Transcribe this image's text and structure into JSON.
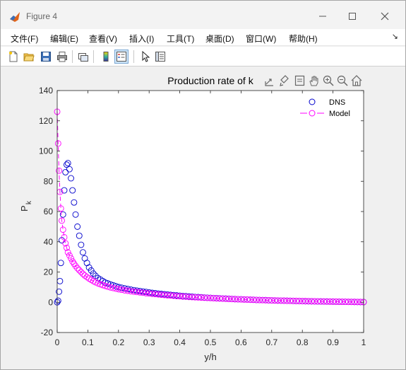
{
  "window": {
    "title": "Figure 4"
  },
  "menu": {
    "items": [
      "文件(F)",
      "编辑(E)",
      "查看(V)",
      "插入(I)",
      "工具(T)",
      "桌面(D)",
      "窗口(W)",
      "帮助(H)"
    ]
  },
  "toolbar": {
    "icons": [
      "new-figure-icon",
      "open-file-icon",
      "save-icon",
      "print-icon",
      "link-plot-icon",
      "colorbar-icon",
      "legend-icon",
      "pointer-icon",
      "property-inspector-icon"
    ]
  },
  "axes_toolbar": {
    "icons": [
      "export-icon",
      "brush-icon",
      "data-tip-icon",
      "pan-icon",
      "zoom-in-icon",
      "zoom-out-icon",
      "home-icon"
    ]
  },
  "colors": {
    "dns": "#0000cc",
    "model": "#ff00ff",
    "figure_bg": "#f0f0f0"
  },
  "chart_data": {
    "type": "scatter",
    "title": "Production rate of k",
    "xlabel": "y/h",
    "ylabel": "P",
    "ylabel_subscript": "k",
    "xlim": [
      0,
      1
    ],
    "ylim": [
      -20,
      140
    ],
    "xticks": [
      "0",
      "0.1",
      "0.2",
      "0.3",
      "0.4",
      "0.5",
      "0.6",
      "0.7",
      "0.8",
      "0.9",
      "1"
    ],
    "yticks": [
      "-20",
      "0",
      "20",
      "40",
      "60",
      "80",
      "100",
      "120",
      "140"
    ],
    "grid": false,
    "legend_position": "top-right",
    "series": [
      {
        "name": "DNS",
        "marker": "circle",
        "line": "none",
        "x": [
          0.0,
          0.003,
          0.006,
          0.009,
          0.012,
          0.015,
          0.019,
          0.023,
          0.027,
          0.031,
          0.035,
          0.04,
          0.045,
          0.05,
          0.055,
          0.06,
          0.066,
          0.072,
          0.078,
          0.084,
          0.09,
          0.097,
          0.104,
          0.111,
          0.118,
          0.125,
          0.133,
          0.141,
          0.149,
          0.157,
          0.165,
          0.174,
          0.183,
          0.192,
          0.201,
          0.21,
          0.22,
          0.23,
          0.24,
          0.25,
          0.26,
          0.27,
          0.28,
          0.29,
          0.3,
          0.31,
          0.32,
          0.33,
          0.34,
          0.35,
          0.36,
          0.37,
          0.38,
          0.39,
          0.4,
          0.41,
          0.42,
          0.43,
          0.44,
          0.45,
          0.46,
          0.47,
          0.48,
          0.49,
          0.5,
          0.51,
          0.52,
          0.53,
          0.54,
          0.55,
          0.56,
          0.57,
          0.58,
          0.59,
          0.6,
          0.61,
          0.62,
          0.63,
          0.64,
          0.65,
          0.66,
          0.67,
          0.68,
          0.69,
          0.7,
          0.71,
          0.72,
          0.73,
          0.74,
          0.75,
          0.76,
          0.77,
          0.78,
          0.79,
          0.8,
          0.81,
          0.82,
          0.83,
          0.84,
          0.85,
          0.86,
          0.87,
          0.88,
          0.89,
          0.9,
          0.91,
          0.92,
          0.93,
          0.94,
          0.95,
          0.96,
          0.97,
          0.98,
          0.99,
          1.0
        ],
        "y": [
          0,
          1,
          7,
          14,
          26,
          41,
          58,
          74,
          86,
          91,
          92,
          88,
          82,
          74,
          66,
          58,
          50,
          44,
          38,
          33,
          29,
          26,
          23,
          21,
          19,
          17.5,
          16,
          15,
          14,
          13,
          12.5,
          11.8,
          11.2,
          10.6,
          10,
          9.6,
          9.2,
          8.8,
          8.4,
          8,
          7.7,
          7.4,
          7.1,
          6.8,
          6.5,
          6.2,
          6,
          5.7,
          5.5,
          5.3,
          5.1,
          4.9,
          4.7,
          4.5,
          4.3,
          4.1,
          4,
          3.8,
          3.7,
          3.5,
          3.4,
          3.3,
          3.1,
          3,
          2.9,
          2.8,
          2.7,
          2.6,
          2.5,
          2.4,
          2.3,
          2.2,
          2.1,
          2,
          1.95,
          1.85,
          1.8,
          1.7,
          1.65,
          1.55,
          1.5,
          1.45,
          1.4,
          1.3,
          1.25,
          1.2,
          1.15,
          1.1,
          1.05,
          1,
          0.95,
          0.9,
          0.85,
          0.8,
          0.75,
          0.7,
          0.68,
          0.64,
          0.6,
          0.56,
          0.53,
          0.5,
          0.47,
          0.44,
          0.41,
          0.38,
          0.35,
          0.33,
          0.3,
          0.28,
          0.25,
          0.23,
          0.2,
          0.18,
          0.15
        ]
      },
      {
        "name": "Model",
        "marker": "circle",
        "line": "dashed",
        "x": [
          0.0,
          0.003,
          0.006,
          0.009,
          0.012,
          0.015,
          0.019,
          0.023,
          0.027,
          0.031,
          0.035,
          0.04,
          0.045,
          0.05,
          0.055,
          0.06,
          0.066,
          0.072,
          0.078,
          0.084,
          0.09,
          0.097,
          0.104,
          0.111,
          0.118,
          0.125,
          0.133,
          0.141,
          0.149,
          0.157,
          0.165,
          0.174,
          0.183,
          0.192,
          0.201,
          0.21,
          0.22,
          0.23,
          0.24,
          0.25,
          0.26,
          0.27,
          0.28,
          0.29,
          0.3,
          0.31,
          0.32,
          0.33,
          0.34,
          0.35,
          0.36,
          0.37,
          0.38,
          0.39,
          0.4,
          0.41,
          0.42,
          0.43,
          0.44,
          0.45,
          0.46,
          0.47,
          0.48,
          0.49,
          0.5,
          0.51,
          0.52,
          0.53,
          0.54,
          0.55,
          0.56,
          0.57,
          0.58,
          0.59,
          0.6,
          0.61,
          0.62,
          0.63,
          0.64,
          0.65,
          0.66,
          0.67,
          0.68,
          0.69,
          0.7,
          0.71,
          0.72,
          0.73,
          0.74,
          0.75,
          0.76,
          0.77,
          0.78,
          0.79,
          0.8,
          0.81,
          0.82,
          0.83,
          0.84,
          0.85,
          0.86,
          0.87,
          0.88,
          0.89,
          0.9,
          0.91,
          0.92,
          0.93,
          0.94,
          0.95,
          0.96,
          0.97,
          0.98,
          0.99,
          1.0
        ],
        "y": [
          126,
          105,
          87,
          73,
          62,
          54,
          48,
          43,
          39,
          36,
          33,
          31,
          29,
          27,
          25.5,
          24,
          22.5,
          21.2,
          20,
          18.8,
          17.7,
          16.7,
          15.7,
          14.8,
          14,
          13.2,
          12.5,
          11.9,
          11.3,
          10.8,
          10.3,
          9.8,
          9.4,
          9,
          8.6,
          8.3,
          7.9,
          7.6,
          7.3,
          7,
          6.8,
          6.5,
          6.3,
          6,
          5.8,
          5.6,
          5.4,
          5.2,
          5,
          4.8,
          4.6,
          4.5,
          4.3,
          4.1,
          4,
          3.8,
          3.7,
          3.5,
          3.4,
          3.3,
          3.2,
          3.1,
          3,
          2.9,
          2.8,
          2.7,
          2.6,
          2.5,
          2.4,
          2.3,
          2.2,
          2.15,
          2.05,
          2,
          1.9,
          1.85,
          1.75,
          1.7,
          1.62,
          1.55,
          1.5,
          1.42,
          1.37,
          1.3,
          1.25,
          1.2,
          1.15,
          1.1,
          1.05,
          1,
          0.96,
          0.92,
          0.88,
          0.84,
          0.8,
          0.76,
          0.72,
          0.68,
          0.64,
          0.6,
          0.57,
          0.54,
          0.5,
          0.47,
          0.44,
          0.41,
          0.38,
          0.35,
          0.32,
          0.29,
          0.26,
          0.23,
          0.2,
          0.17,
          0.15
        ]
      }
    ]
  }
}
